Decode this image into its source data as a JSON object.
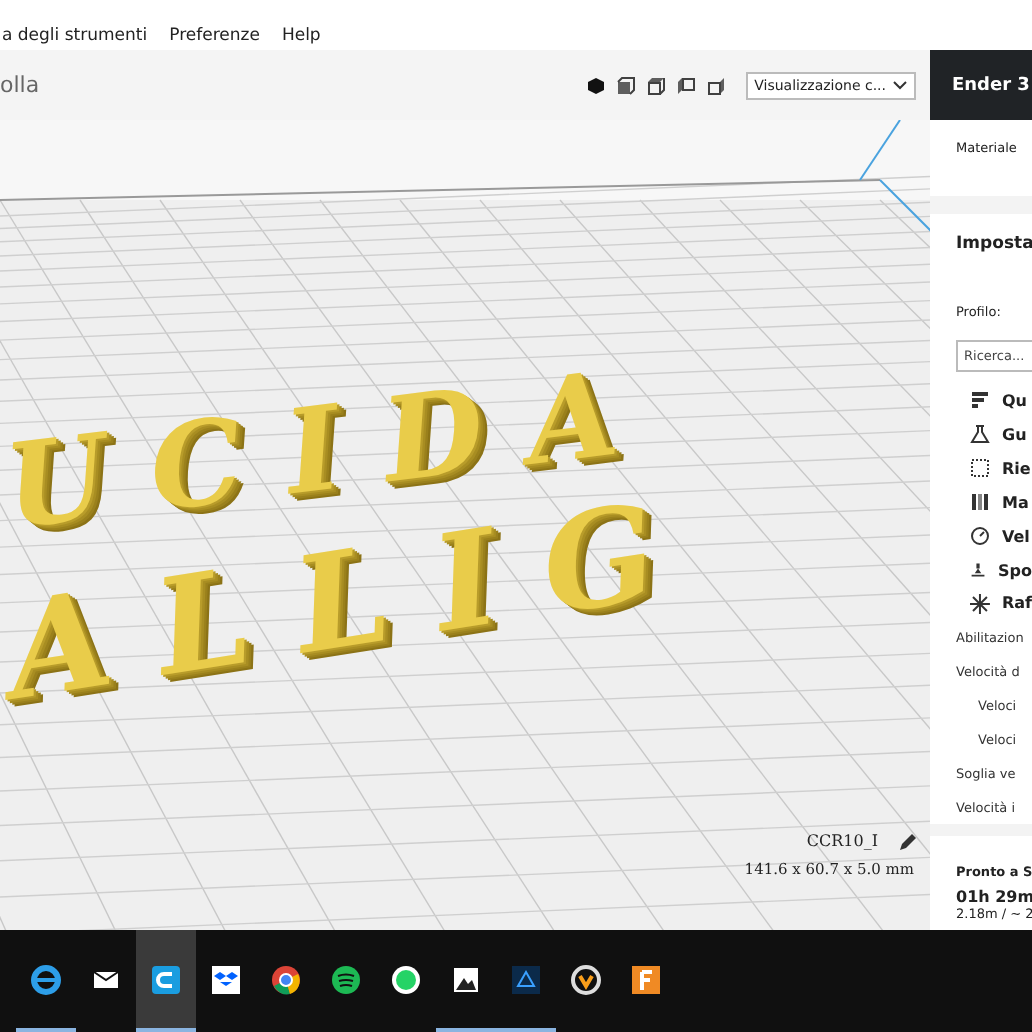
{
  "menu_bar": {
    "items": [
      "a degli strumenti",
      "Preferenze",
      "Help"
    ]
  },
  "toolbar": {
    "title": "olla",
    "view_buttons": [
      {
        "kind": "perspective",
        "selected": true
      },
      {
        "kind": "front",
        "selected": false
      },
      {
        "kind": "top",
        "selected": false
      },
      {
        "kind": "left",
        "selected": false
      },
      {
        "kind": "right",
        "selected": false
      }
    ],
    "view_dropdown": "Visualizzazione c..."
  },
  "viewport": {
    "model_text": [
      "UCIDA",
      "ALLIG"
    ],
    "object_name": "CCR10_I",
    "object_size": "141.6 x 60.7 x 5.0 mm"
  },
  "sidebar": {
    "printer": "Ender 3",
    "material_label": "Materiale",
    "settings_title": "Imposta",
    "profile_label": "Profilo:",
    "search_placeholder": "Ricerca...",
    "categories": [
      "Qu",
      "Gu",
      "Rie",
      "Ma",
      "Vel",
      "Spo",
      "Raf"
    ],
    "settings": [
      {
        "label": "Abilitazion"
      },
      {
        "label": "Velocità d",
        "children": [
          {
            "label": "Veloci"
          },
          {
            "label": "Veloci"
          }
        ]
      },
      {
        "label": "Soglia ve"
      },
      {
        "label": "Velocità i"
      }
    ],
    "status": "Pronto a S",
    "time": "01h 29m",
    "material_usage": "2.18m / ~ 2"
  },
  "taskbar": {
    "apps": [
      {
        "kind": "browser",
        "running": true,
        "selected": false
      },
      {
        "kind": "mail",
        "running": false,
        "selected": false
      },
      {
        "kind": "cura",
        "running": true,
        "selected": true
      },
      {
        "kind": "dropbox",
        "running": false,
        "selected": false
      },
      {
        "kind": "chrome",
        "running": false,
        "selected": false
      },
      {
        "kind": "spotify",
        "running": false,
        "selected": false
      },
      {
        "kind": "whatsapp",
        "running": false,
        "selected": false
      },
      {
        "kind": "photos",
        "running": true,
        "selected": false
      },
      {
        "kind": "network",
        "running": true,
        "selected": false
      },
      {
        "kind": "overwatch",
        "running": false,
        "selected": false
      },
      {
        "kind": "fusion",
        "running": false,
        "selected": false
      }
    ]
  }
}
